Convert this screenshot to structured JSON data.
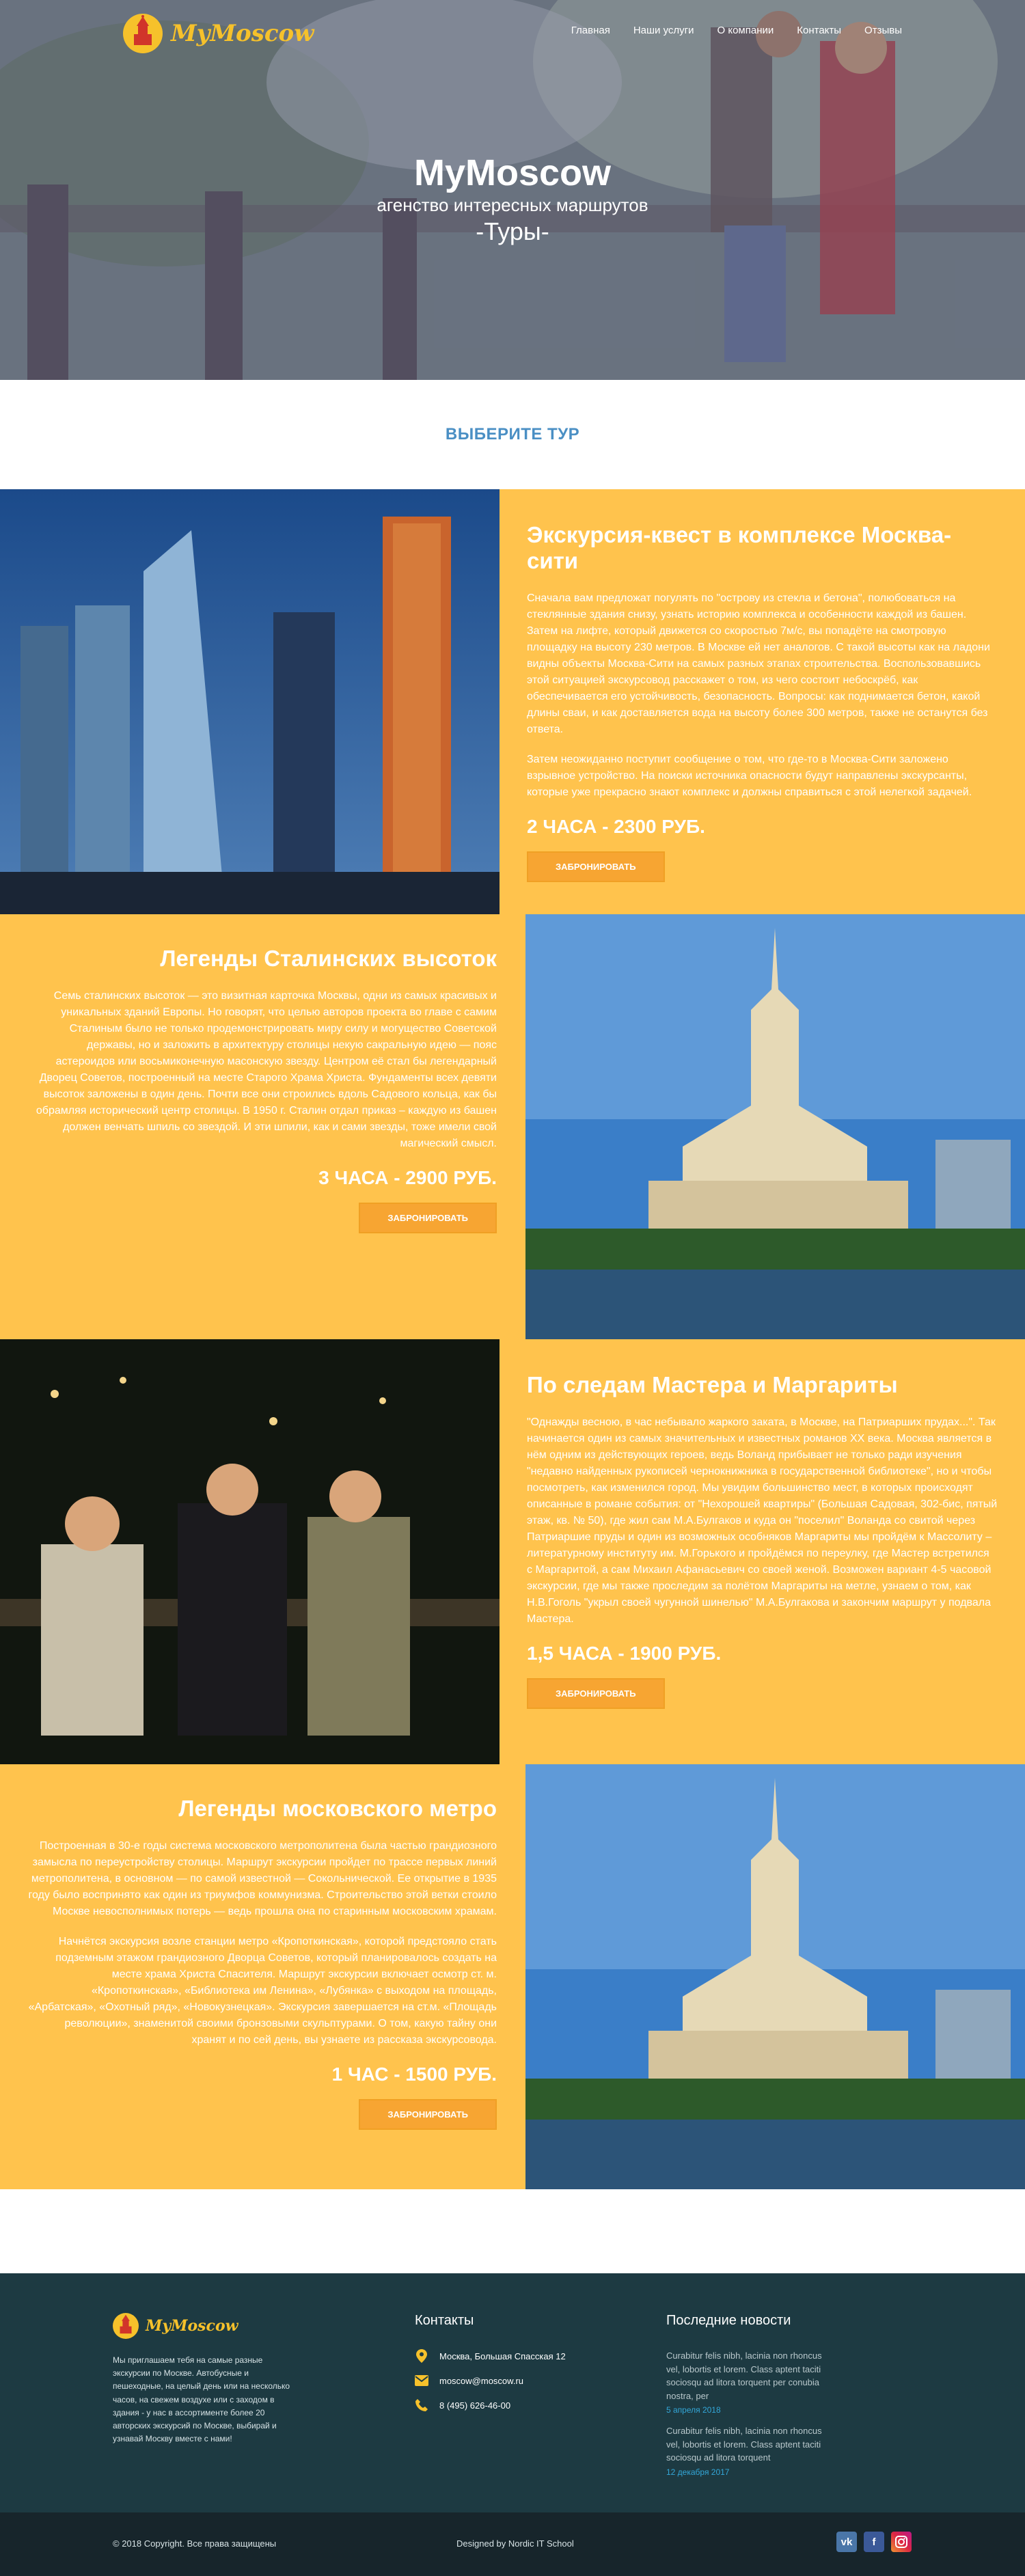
{
  "nav": {
    "logo_text": "MyMoscow",
    "items": [
      "Главная",
      "Наши услуги",
      "О компании",
      "Контакты",
      "Отзывы"
    ]
  },
  "hero": {
    "title": "MyMoscow",
    "subtitle": "агенство интересных маршрутов",
    "tagline": "-Туры-"
  },
  "section_title": "ВЫБЕРИТЕ ТУР",
  "tours": [
    {
      "title": "Экскурсия-квест в комплексе Москва-сити",
      "paragraphs": [
        "Сначала вам предложат погулять по \"острову из стекла и бетона\", полюбоваться на стеклянные здания снизу, узнать историю комплекса и особенности каждой из башен. Затем на лифте, который движется со скоростью 7м/с, вы попадёте на смотровую площадку на высоту 230 метров. В Москве ей нет аналогов. С такой высоты как на ладони видны объекты Москва-Сити на самых разных этапах строительства. Воспользовавшись этой ситуацией экскурсовод расскажет о том, из чего состоит небоскрёб, как обеспечивается его устойчивость, безопасность. Вопросы: как поднимается бетон, какой длины сваи, и как доставляется вода на высоту более 300 метров, также не останутся без ответа.",
        "Затем неожиданно поступит сообщение о том, что где-то в Москва-Сити заложено взрывное устройство. На поиски источника опасности будут направлены экскурсанты, которые уже прекрасно знают комплекс и должны справиться с этой нелегкой задачей."
      ],
      "price": "2 ЧАСА - 2300 РУБ.",
      "button": "ЗАБРОНИРОВАТЬ"
    },
    {
      "title": "Легенды Сталинских высоток",
      "paragraphs": [
        "Семь сталинских высоток — это визитная карточка Москвы, одни из самых красивых и уникальных зданий Европы. Но говорят, что целью авторов проекта во главе с самим Сталиным было не только продемонстрировать миру силу и могущество Советской державы, но и заложить в архитектуру столицы некую сакральную идею — пояс астероидов или восьмиконечную масонскую звезду. Центром её стал бы легендарный Дворец Советов, построенный на месте Старого Храма Христа. Фундаменты всех девяти высоток заложены в один день. Почти все они строились вдоль Садового кольца, как бы обрамляя исторический центр столицы. В 1950 г. Сталин отдал приказ – каждую из башен должен венчать шпиль со звездой. И эти шпили, как и сами звезды, тоже имели свой магический смысл."
      ],
      "price": "3 ЧАСА - 2900 РУБ.",
      "button": "ЗАБРОНИРОВАТЬ"
    },
    {
      "title": "По следам Мастера и Маргариты",
      "paragraphs": [
        "\"Однажды весною, в час небывало жаркого заката, в Москве, на Патриарших прудах...\". Так начинается один из самых значительных и известных романов XX века. Москва является в нём одним из действующих героев, ведь Воланд прибывает не только ради изучения \"недавно найденных рукописей чернокнижника в государственной библиотеке\", но и чтобы посмотреть, как изменился город. Мы увидим большинство мест, в которых происходят описанные в романе события: от \"Нехорошей квартиры\" (Большая Садовая, 302-бис, пятый этаж, кв. № 50), где жил сам М.А.Булгаков и куда он \"поселил\" Воланда со свитой через Патриаршие пруды и один из возможных особняков Маргариты мы пройдём к Массолиту – литературному институту им. М.Горького и пройдёмся по переулку, где Мастер встретился с Маргаритой, а сам Михаил Афанасьевич со своей женой. Возможен вариант 4-5 часовой экскурсии, где мы также проследим за полётом Маргариты на метле, узнаем о том, как Н.В.Гоголь \"укрыл своей чугунной шинелью\" М.А.Булгакова и закончим маршрут у подвала Мастера."
      ],
      "price": "1,5 ЧАСА - 1900 РУБ.",
      "button": "ЗАБРОНИРОВАТЬ"
    },
    {
      "title": "Легенды московского метро",
      "paragraphs": [
        "Построенная в 30-е годы система московского метрополитена была частью грандиозного замысла по переустройству столицы. Маршрут экскурсии пройдет по трассе первых линий метрополитена, в основном — по самой известной — Сокольнической. Ее открытие в 1935 году было воспринято как один из триумфов коммунизма. Строительство этой ветки стоило Москве невосполнимых потерь — ведь прошла она по старинным московским храмам.",
        "Начнётся экскурсия возле станции метро «Кропоткинская», которой предстояло стать подземным этажом грандиозного Дворца Советов, который планировалось создать на месте храма Христа Спасителя. Маршрут экскурсии включает осмотр ст. м. «Кропоткинская», «Библиотека им Ленина», «Лубянка» с выходом на площадь, «Арбатская», «Охотный ряд», «Новокузнецкая». Экскурсия завершается на ст.м. «Площадь революции», знаменитой своими бронзовыми скульптурами. О том, какую тайну они хранят и по сей день, вы узнаете из рассказа экскурсовода."
      ],
      "price": "1 ЧАС - 1500 РУБ.",
      "button": "ЗАБРОНИРОВАТЬ"
    }
  ],
  "footer": {
    "logo_text": "MyMoscow",
    "about": "Мы приглашаем тебя на самые разные экскурсии по Москве. Автобусные и пешеходные, на целый день или на несколько часов, на свежем воздухе или с заходом в здания - у нас в ассортименте более 20 авторских экскурсий по Москве, выбирай и узнавай Москву вместе с нами!",
    "contacts_title": "Контакты",
    "address": "Москва, Большая Спасская 12",
    "email": "moscow@moscow.ru",
    "phone": "8 (495) 626-46-00",
    "news_title": "Последние новости",
    "news": [
      {
        "text": "Curabitur felis nibh, lacinia non rhoncus vel, lobortis et lorem. Class aptent taciti sociosqu ad litora torquent per conubia nostra, per",
        "date": "5 апреля 2018"
      },
      {
        "text": "Curabitur felis nibh, lacinia non rhoncus vel, lobortis et lorem. Class aptent taciti sociosqu ad litora torquent",
        "date": "12 декабря 2017"
      }
    ],
    "copyright": "© 2018 Copyright. Все права защищены",
    "designed_by": "Designed by Nordic IT School",
    "social": [
      "vk-icon",
      "facebook-icon",
      "instagram-icon"
    ]
  }
}
